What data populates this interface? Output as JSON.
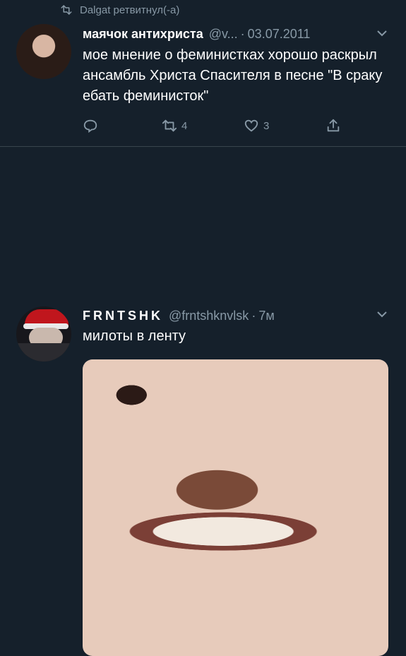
{
  "retweet": {
    "label": "Dalgat ретвитнул(-а)"
  },
  "tweets": [
    {
      "name": "маячок антихриста",
      "handle": "@v...",
      "dot": "·",
      "time": "03.07.2011",
      "text": "мое мнение о феминистках хорошо раскрыл ансамбль Христа Спасителя в песне \"В сраку ебать феминисток\"",
      "actions": {
        "retweets": "4",
        "likes": "3"
      }
    },
    {
      "name": "FRNTSHK",
      "handle": "@frntshknvlsk",
      "dot": "·",
      "time": "7м",
      "text": "милоты в ленту"
    }
  ],
  "colors": {
    "background": "#15202b",
    "secondary_text": "#8899a6",
    "divider": "#38444d"
  },
  "icons": [
    "retweet-icon",
    "chevron-down-icon",
    "reply-icon",
    "like-icon",
    "share-icon"
  ]
}
